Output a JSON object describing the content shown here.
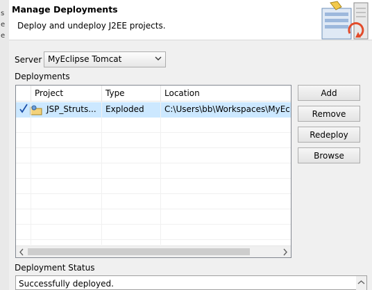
{
  "header": {
    "title": "Manage Deployments",
    "description": "Deploy and undeploy J2EE projects."
  },
  "server": {
    "label": "Server",
    "selected": "MyEclipse Tomcat"
  },
  "deployments": {
    "label": "Deployments",
    "columns": [
      "Project",
      "Type",
      "Location"
    ],
    "rows": [
      {
        "checked": true,
        "project": "JSP_Struts...",
        "type": "Exploded",
        "location": "C:\\Users\\bb\\Workspaces\\MyEc"
      }
    ]
  },
  "buttons": {
    "add": "Add",
    "remove": "Remove",
    "redeploy": "Redeploy",
    "browse": "Browse"
  },
  "status": {
    "label": "Deployment Status",
    "message": "Successfully deployed."
  },
  "background_window": {
    "edge_chars": [
      "s",
      "e",
      "e"
    ]
  },
  "colors": {
    "selection": "#cce8ff",
    "check": "#1a4ea8"
  }
}
